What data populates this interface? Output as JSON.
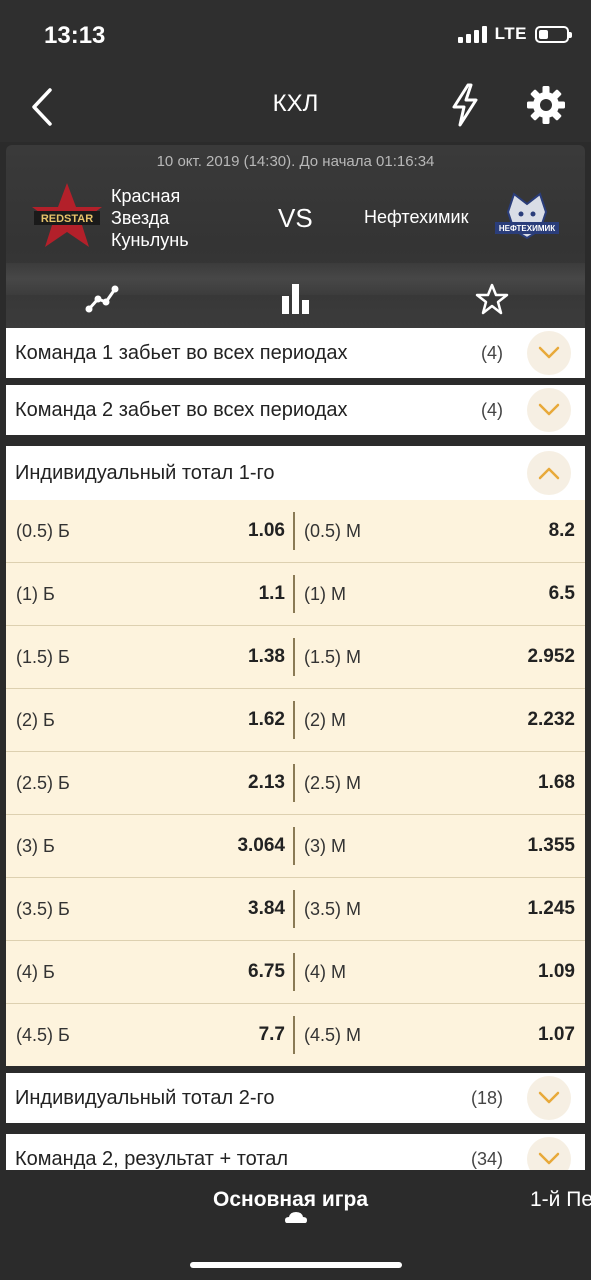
{
  "status_bar": {
    "time": "13:13",
    "network": "LTE"
  },
  "nav": {
    "title": "КХЛ",
    "back_icon": "chevron-left-icon",
    "bolt_icon": "lightning-icon",
    "settings_icon": "gear-icon"
  },
  "match": {
    "date_line": "10 окт. 2019 (14:30). До начала   01:16:34",
    "team1": {
      "name": "Красная Звезда Куньлунь",
      "logo_text": "REDSTAR"
    },
    "vs": "VS",
    "team2": {
      "name": "Нефтехимик",
      "logo_text": "НЕФТЕХИМИК"
    },
    "tabs": [
      "trend-icon",
      "stats-bars-icon",
      "star-icon"
    ]
  },
  "colors": {
    "accent": "#e8a93a",
    "odds_bg": "#fdf3dd",
    "dark_bg": "#2b2b2b"
  },
  "markets_above": [
    {
      "label": "Команда 1 забьет во всех периодах",
      "count": "(4)"
    },
    {
      "label": "Команда 2 забьет во всех периодах",
      "count": "(4)"
    }
  ],
  "expanded_market": {
    "label": "Индивидуальный тотал 1-го",
    "rows": [
      {
        "left_label": "(0.5) Б",
        "left_value": "1.06",
        "right_label": "(0.5) М",
        "right_value": "8.2"
      },
      {
        "left_label": "(1) Б",
        "left_value": "1.1",
        "right_label": "(1) М",
        "right_value": "6.5"
      },
      {
        "left_label": "(1.5) Б",
        "left_value": "1.38",
        "right_label": "(1.5) М",
        "right_value": "2.952"
      },
      {
        "left_label": "(2) Б",
        "left_value": "1.62",
        "right_label": "(2) М",
        "right_value": "2.232"
      },
      {
        "left_label": "(2.5) Б",
        "left_value": "2.13",
        "right_label": "(2.5) М",
        "right_value": "1.68"
      },
      {
        "left_label": "(3) Б",
        "left_value": "3.064",
        "right_label": "(3) М",
        "right_value": "1.355"
      },
      {
        "left_label": "(3.5) Б",
        "left_value": "3.84",
        "right_label": "(3.5) М",
        "right_value": "1.245"
      },
      {
        "left_label": "(4) Б",
        "left_value": "6.75",
        "right_label": "(4) М",
        "right_value": "1.09"
      },
      {
        "left_label": "(4.5) Б",
        "left_value": "7.7",
        "right_label": "(4.5) М",
        "right_value": "1.07"
      }
    ]
  },
  "markets_below": [
    {
      "label": "Индивидуальный тотал 2-го",
      "count": "(18)"
    },
    {
      "label": "Команда 2, результат + тотал",
      "count": "(34)"
    }
  ],
  "bottom_tabs": {
    "main": "Основная игра",
    "next": "1-й Пе"
  }
}
